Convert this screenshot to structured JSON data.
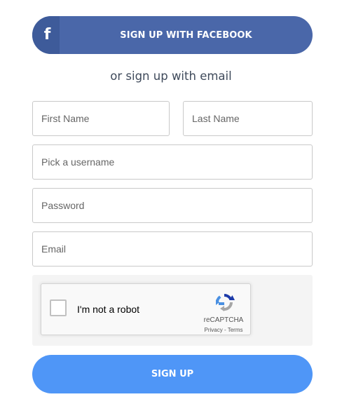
{
  "facebook": {
    "icon": "facebook-f-icon",
    "icon_glyph": "f",
    "label": "SIGN UP WITH FACEBOOK",
    "color": "#4a67a9",
    "icon_bg_color": "#3e5b9a"
  },
  "divider": {
    "text": "or sign up with email"
  },
  "form": {
    "first_name": {
      "placeholder": "First Name",
      "value": ""
    },
    "last_name": {
      "placeholder": "Last Name",
      "value": ""
    },
    "username": {
      "placeholder": "Pick a username",
      "value": ""
    },
    "password": {
      "placeholder": "Password",
      "value": ""
    },
    "email": {
      "placeholder": "Email",
      "value": ""
    }
  },
  "recaptcha": {
    "checkbox_label": "I'm not a robot",
    "checked": false,
    "brand": "reCAPTCHA",
    "privacy_link": "Privacy",
    "separator": " - ",
    "terms_link": "Terms",
    "icon": "recaptcha-logo-icon"
  },
  "signup": {
    "label": "SIGN UP",
    "color": "#4f96f7"
  }
}
